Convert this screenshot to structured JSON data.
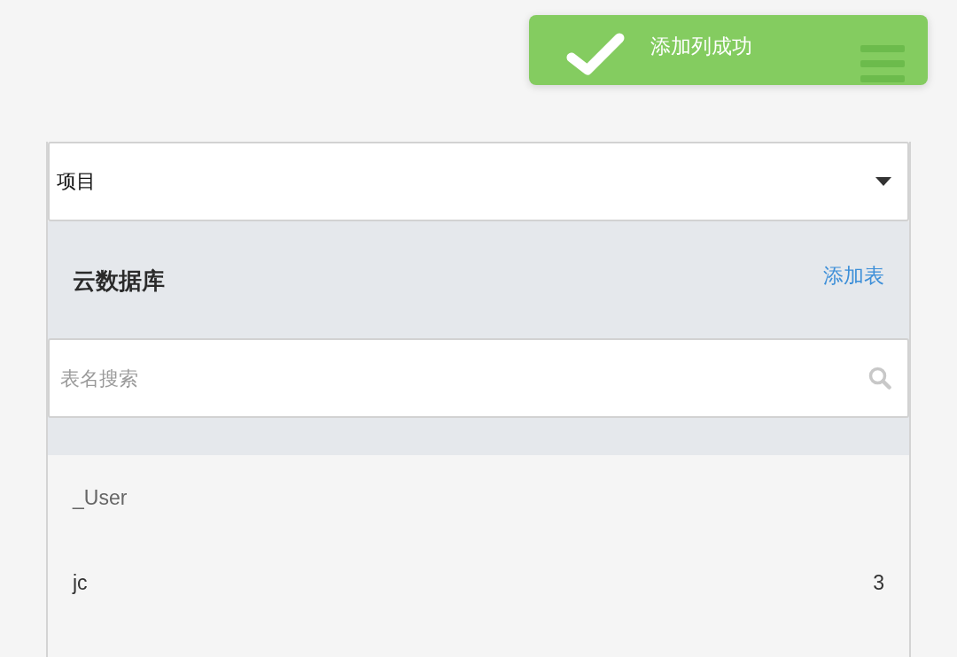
{
  "toast": {
    "message": "添加列成功"
  },
  "project_select": {
    "value": "项目"
  },
  "database": {
    "title": "云数据库",
    "add_table_link": "添加表"
  },
  "search": {
    "placeholder": "表名搜索"
  },
  "tables": [
    {
      "name": "_User",
      "muted": true
    },
    {
      "name": "jc",
      "count": "3",
      "muted": false
    }
  ]
}
